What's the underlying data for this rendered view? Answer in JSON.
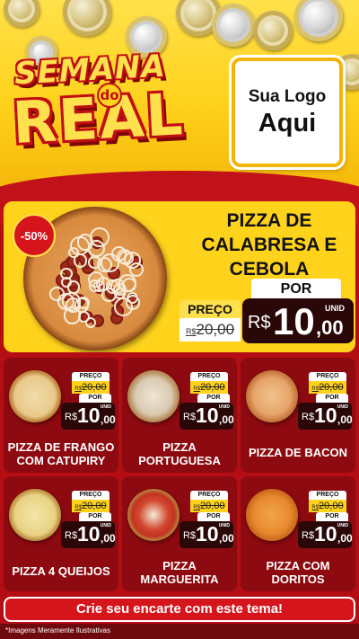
{
  "header": {
    "title_line1": "SEMANA",
    "title_de": "do",
    "title_line2": "REAL",
    "logo_line1": "Sua Logo",
    "logo_line2": "Aqui"
  },
  "colors": {
    "background_red": "#b50d14",
    "accent_yellow": "#ffd21c",
    "price_box": "#2a0808",
    "card_red": "#8c0a10"
  },
  "featured": {
    "discount_badge": "-50%",
    "name": "PIZZA DE CALABRESA E CEBOLA",
    "old_label": "PREÇO",
    "old_currency": "R$",
    "old_price": "20,00",
    "new_label": "POR",
    "currency": "R$",
    "price_int": "10",
    "price_cents": ",00",
    "unit": "UNID"
  },
  "products": [
    {
      "name": "PIZZA DE FRANGO COM CATUPIRY",
      "old_label": "PREÇO",
      "old_currency": "R$",
      "old_price": "20,00",
      "new_label": "POR",
      "currency": "R$",
      "price_int": "10",
      "price_cents": ",00",
      "unit": "UNID",
      "icon": "pizza-frango-icon"
    },
    {
      "name": "PIZZA PORTUGUESA",
      "old_label": "PREÇO",
      "old_currency": "R$",
      "old_price": "20,00",
      "new_label": "POR",
      "currency": "R$",
      "price_int": "10",
      "price_cents": ",00",
      "unit": "UNID",
      "icon": "pizza-portuguesa-icon"
    },
    {
      "name": "PIZZA DE BACON",
      "old_label": "PREÇO",
      "old_currency": "R$",
      "old_price": "20,00",
      "new_label": "POR",
      "currency": "R$",
      "price_int": "10",
      "price_cents": ",00",
      "unit": "UNID",
      "icon": "pizza-bacon-icon"
    },
    {
      "name": "PIZZA 4 QUEIJOS",
      "old_label": "PREÇO",
      "old_currency": "R$",
      "old_price": "20,00",
      "new_label": "POR",
      "currency": "R$",
      "price_int": "10",
      "price_cents": ",00",
      "unit": "UNID",
      "icon": "pizza-queijos-icon"
    },
    {
      "name": "PIZZA MARGUERITA",
      "old_label": "PREÇO",
      "old_currency": "R$",
      "old_price": "20,00",
      "new_label": "POR",
      "currency": "R$",
      "price_int": "10",
      "price_cents": ",00",
      "unit": "UNID",
      "icon": "pizza-marguerita-icon"
    },
    {
      "name": "PIZZA COM DORITOS",
      "old_label": "PREÇO",
      "old_currency": "R$",
      "old_price": "20,00",
      "new_label": "POR",
      "currency": "R$",
      "price_int": "10",
      "price_cents": ",00",
      "unit": "UNID",
      "icon": "pizza-doritos-icon"
    }
  ],
  "cta": {
    "label": "Crie seu encarte com este tema!"
  },
  "footnote": "*Imagens Meramente Ilustrativas"
}
